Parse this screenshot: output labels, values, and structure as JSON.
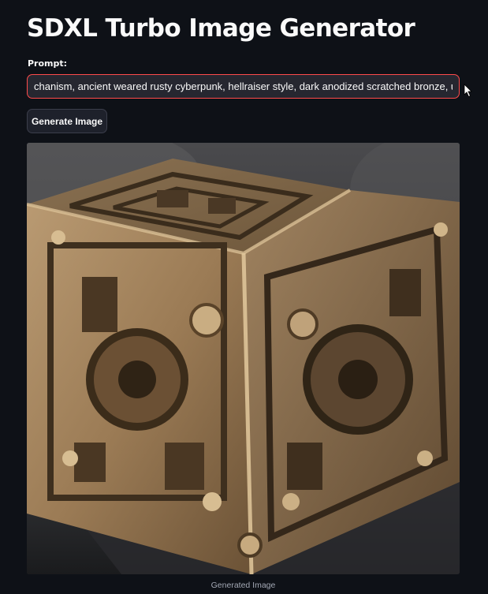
{
  "app": {
    "title": "SDXL Turbo Image Generator"
  },
  "prompt": {
    "label": "Prompt:",
    "value": "chanism, ancient weared rusty cyberpunk, hellraiser style, dark anodized scratched bronze, ultra detail"
  },
  "generate_button": {
    "label": "Generate Image"
  },
  "output": {
    "image_alt": "Generated image of an ornate mechanical bronze cube puzzle box",
    "caption": "Generated Image"
  },
  "colors": {
    "background": "#0e1117",
    "input_background": "#262730",
    "input_border_focus": "#ff4b4b",
    "button_background": "#1e212b",
    "text": "#fafafa",
    "caption_text": "#a3a8b4"
  }
}
